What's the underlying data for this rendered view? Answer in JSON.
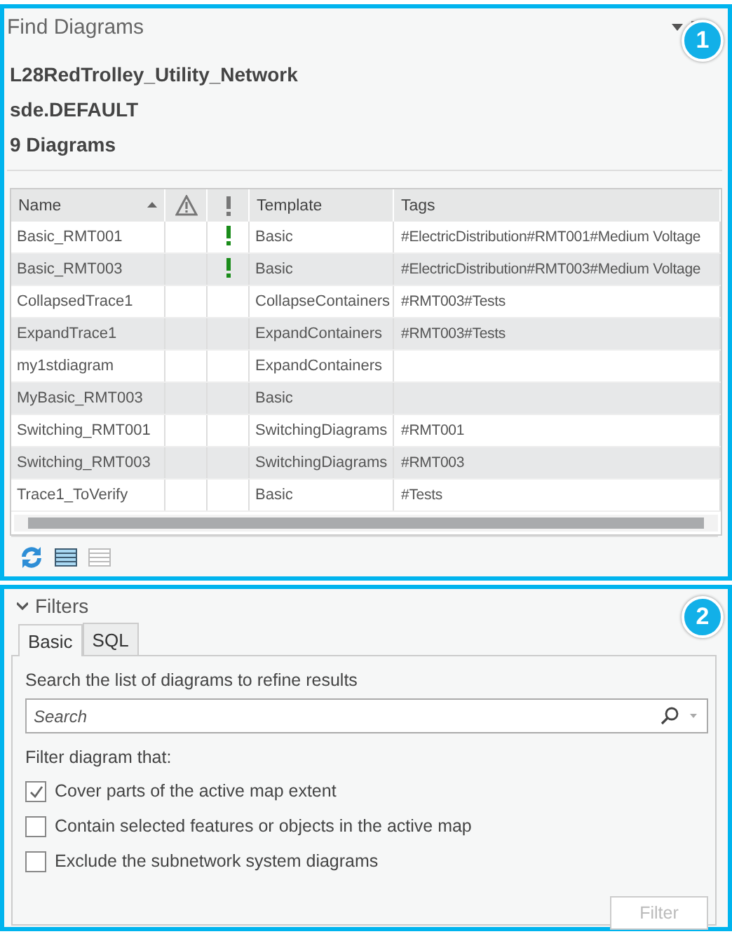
{
  "window": {
    "title": "Find Diagrams"
  },
  "callouts": [
    "1",
    "2"
  ],
  "info": [
    "L28RedTrolley_Utility_Network",
    "sde.DEFAULT",
    "9 Diagrams"
  ],
  "table": {
    "columns": [
      {
        "kind": "text",
        "label": "Name",
        "sorted_ascending": true
      },
      {
        "kind": "warning"
      },
      {
        "kind": "flag"
      },
      {
        "kind": "text",
        "label": "Template"
      },
      {
        "kind": "text",
        "label": "Tags"
      }
    ],
    "rows": [
      {
        "name": "Basic_RMT001",
        "flagged": true,
        "template": "Basic",
        "tags": "#ElectricDistribution#RMT001#Medium Voltage"
      },
      {
        "name": "Basic_RMT003",
        "flagged": true,
        "template": "Basic",
        "tags": "#ElectricDistribution#RMT003#Medium Voltage"
      },
      {
        "name": "CollapsedTrace1",
        "flagged": false,
        "template": "CollapseContainers",
        "tags": "#RMT003#Tests"
      },
      {
        "name": "ExpandTrace1",
        "flagged": false,
        "template": "ExpandContainers",
        "tags": "#RMT003#Tests"
      },
      {
        "name": "my1stdiagram",
        "flagged": false,
        "template": "ExpandContainers"
      },
      {
        "name": "MyBasic_RMT003",
        "flagged": false,
        "template": "Basic"
      },
      {
        "name": "Switching_RMT001",
        "flagged": false,
        "template": "SwitchingDiagrams",
        "tags": "#RMT001"
      },
      {
        "name": "Switching_RMT003",
        "flagged": false,
        "template": "SwitchingDiagrams",
        "tags": "#RMT003"
      },
      {
        "name": "Trace1_ToVerify",
        "flagged": false,
        "template": "Basic",
        "tags": "#Tests"
      }
    ]
  },
  "view_buttons": [
    {
      "selected": true
    },
    {
      "selected": false
    }
  ],
  "filters": {
    "title": "Filters",
    "expanded": true,
    "tabs": [
      {
        "label": "Basic",
        "selected": true
      },
      {
        "label": "SQL",
        "selected": false
      }
    ],
    "description": "Search the list of diagrams to refine results",
    "search": {
      "placeholder": "Search"
    },
    "criteria_label": "Filter diagram that:",
    "options": [
      {
        "label": "Cover parts of the active map extent",
        "checked": true
      },
      {
        "label": "Contain selected features or objects in the active map",
        "checked": false
      },
      {
        "label": "Exclude the subnetwork system diagrams",
        "checked": false
      }
    ],
    "button": {
      "label": "Filter",
      "disabled": true
    }
  }
}
